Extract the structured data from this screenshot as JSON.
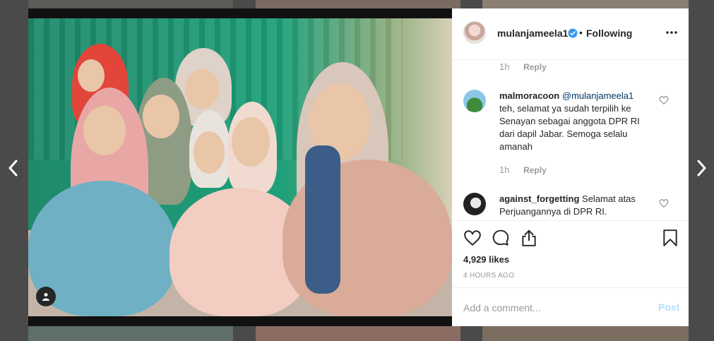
{
  "post": {
    "username": "mulanjameela1",
    "separator": "•",
    "follow_status": "Following",
    "likes": "4,929 likes",
    "time_ago": "4 HOURS AGO"
  },
  "comments": [
    {
      "time": "1h",
      "reply_label": "Reply"
    },
    {
      "username": "malmoracoon",
      "mention": "@mulanjameela1",
      "text": "teh, selamat ya sudah terpilih ke Senayan sebagai anggota DPR RI dari dapil Jabar. Semoga selalu amanah",
      "time": "1h",
      "reply_label": "Reply"
    },
    {
      "username": "against_forgetting",
      "text": "Selamat atas Perjuangannya di DPR RI."
    }
  ],
  "add_comment": {
    "placeholder": "Add a comment...",
    "post_label": "Post"
  },
  "colors": {
    "verified": "#3897f0",
    "post_button_disabled": "#b2dffc",
    "meta_gray": "#999999",
    "mention": "#003569"
  },
  "icons": [
    "chevron-left-icon",
    "chevron-right-icon",
    "verified-badge-icon",
    "more-options-icon",
    "heart-icon",
    "comment-icon",
    "share-icon",
    "bookmark-icon",
    "user-tag-icon"
  ]
}
